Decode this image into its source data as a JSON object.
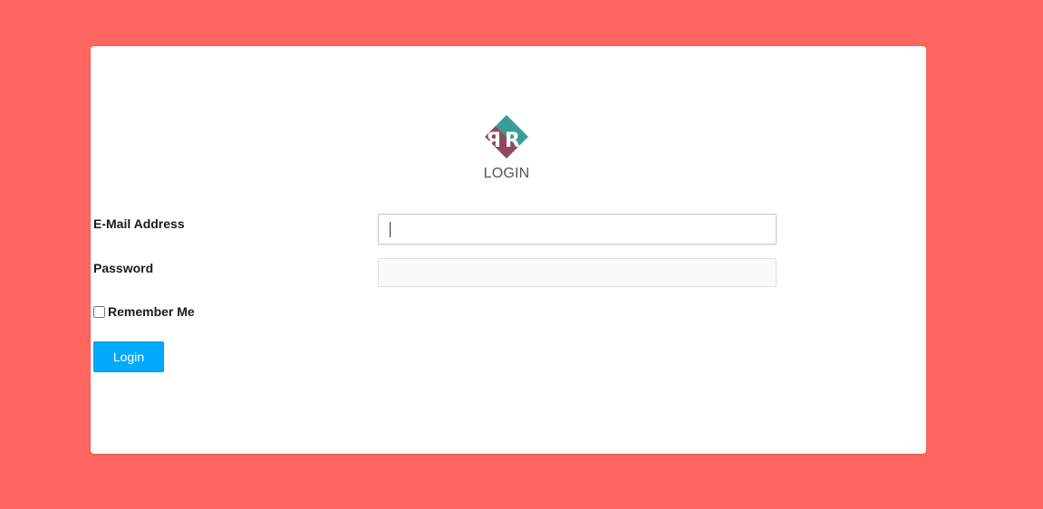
{
  "brand": {
    "logo_icon": "rr-diamond-logo-icon",
    "colors": {
      "teal": "#3a9e96",
      "maroon": "#8e4a5b",
      "background": "#ff6660",
      "button": "#00aaff"
    }
  },
  "form": {
    "heading": "LOGIN",
    "email": {
      "label": "E-Mail Address",
      "value": ""
    },
    "password": {
      "label": "Password",
      "value": ""
    },
    "remember": {
      "label": "Remember Me",
      "checked": false
    },
    "submit_label": "Login"
  }
}
